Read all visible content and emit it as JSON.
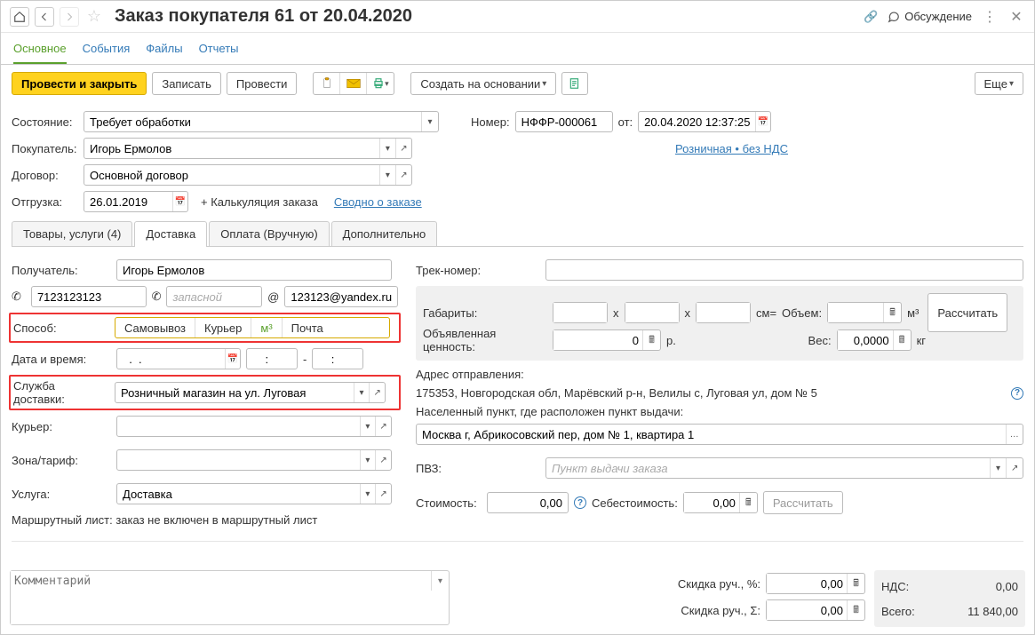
{
  "top": {
    "title": "Заказ покупателя 61 от 20.04.2020",
    "discuss": "Обсуждение"
  },
  "nav": {
    "main": "Основное",
    "events": "События",
    "files": "Файлы",
    "reports": "Отчеты"
  },
  "cmd": {
    "post_close": "Провести и закрыть",
    "save": "Записать",
    "post": "Провести",
    "create_based": "Создать на основании",
    "more": "Еще"
  },
  "form": {
    "state_lbl": "Состояние:",
    "state_val": "Требует обработки",
    "number_lbl": "Номер:",
    "number_val": "НФФР-000061",
    "from_lbl": "от:",
    "date_val": "20.04.2020 12:37:25",
    "buyer_lbl": "Покупатель:",
    "buyer_val": "Игорь Ермолов",
    "price_link": "Розничная • без НДС",
    "contract_lbl": "Договор:",
    "contract_val": "Основной договор",
    "shipment_lbl": "Отгрузка:",
    "shipment_val": "26.01.2019",
    "calc_text": "+ Калькуляция заказа",
    "summary_link": "Сводно о заказе"
  },
  "tabs": {
    "goods": "Товары, услуги (4)",
    "delivery": "Доставка",
    "payment": "Оплата (Вручную)",
    "extra": "Дополнительно"
  },
  "delivery": {
    "recipient_lbl": "Получатель:",
    "recipient_val": "Игорь Ермолов",
    "phone1": "7123123123",
    "phone2_ph": "запасной",
    "email": "123123@yandex.ru",
    "method_lbl": "Способ:",
    "m1": "Самовывоз",
    "m2": "Курьер",
    "m3": "м³",
    "m4": "Почта",
    "datetime_lbl": "Дата и время:",
    "date_ph": "  .  .    ",
    "time1": "    :    ",
    "time_dash": "-",
    "time2": "    :    ",
    "service_lbl": "Служба доставки:",
    "service_val": "Розничный магазин на ул. Луговая",
    "courier_lbl": "Курьер:",
    "zone_lbl": "Зона/тариф:",
    "uslugа_lbl": "Услуга:",
    "uslugа_val": "Доставка",
    "route_text": "Маршрутный лист: заказ не включен в маршрутный лист",
    "track_lbl": "Трек-номер:",
    "dims_lbl": "Габариты:",
    "x": "x",
    "cm": "см=",
    "vol_lbl": "Объем:",
    "declared_lbl": "Объявленная ценность:",
    "declared_val": "0",
    "rub": "р.",
    "weight_lbl": "Вес:",
    "weight_val": "0,0000",
    "kg": "кг",
    "calc_btn": "Рассчитать",
    "addr_from_lbl": "Адрес отправления:",
    "addr_from_val": "175353, Новгородская обл, Марёвский р-н, Велилы с, Луговая ул, дом № 5",
    "city_lbl": "Населенный пункт, где расположен пункт выдачи:",
    "city_val": "Москва г, Абрикосовский пер, дом № 1, квартира 1",
    "pvz_lbl": "ПВЗ:",
    "pvz_ph": "Пункт выдачи заказа",
    "cost_lbl": "Стоимость:",
    "cost_val": "0,00",
    "selfcost_lbl": "Себестоимость:",
    "selfcost_val": "0,00",
    "calc2_btn": "Рассчитать"
  },
  "footer": {
    "comment_ph": "Комментарий",
    "disc_perc_lbl": "Скидка руч., %:",
    "disc_perc_val": "0,00",
    "disc_sum_lbl": "Скидка руч., Σ:",
    "disc_sum_val": "0,00",
    "nds_lbl": "НДС:",
    "nds_val": "0,00",
    "total_lbl": "Всего:",
    "total_val": "11 840,00"
  }
}
